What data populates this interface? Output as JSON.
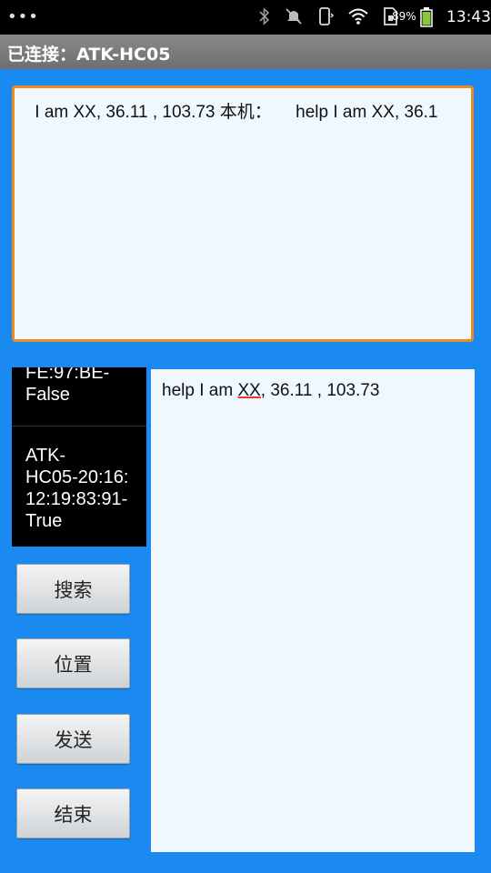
{
  "status_bar": {
    "battery_percent": "89%",
    "time": "13:43",
    "icons": [
      "more-dots-icon",
      "bluetooth-icon",
      "mute-icon",
      "vibrate-icon",
      "wifi-icon",
      "sim-icon",
      "battery-icon"
    ]
  },
  "app": {
    "title": "已连接：ATK-HC05"
  },
  "received": {
    "text": " I am XX, 36.11 , 103.73 本机：     help I am XX, 36.1"
  },
  "devices": [
    {
      "line1": "FE:97:BE-",
      "line2": "False"
    },
    {
      "lines": [
        "ATK-",
        "HC05-20:16:",
        "12:19:83:91-",
        "True"
      ]
    }
  ],
  "buttons": {
    "search": "搜索",
    "location": "位置",
    "send": "发送",
    "end": "结束"
  },
  "input": {
    "before": "help I am ",
    "underlined": "XX",
    "after": ", 36.11 , 103.73"
  }
}
